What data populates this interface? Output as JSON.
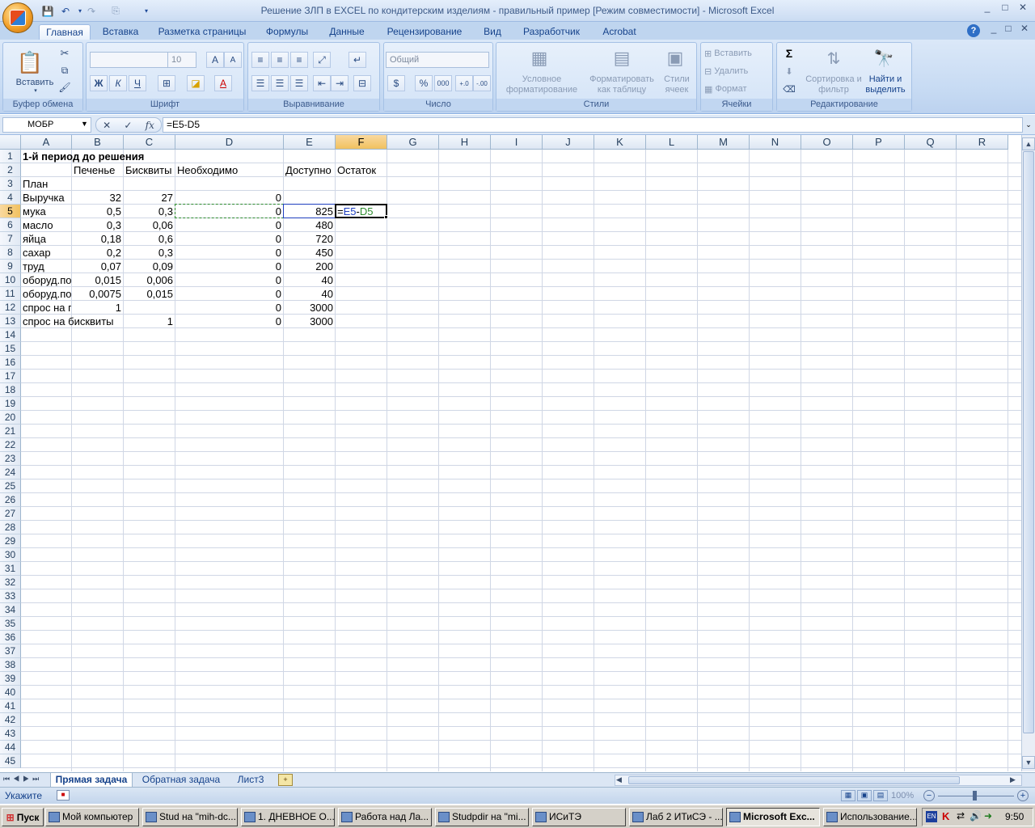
{
  "window": {
    "title": "Решение ЗЛП в EXCEL по кондитерским изделиям - правильный пример  [Режим совместимости] - Microsoft Excel",
    "min": "_",
    "max": "□",
    "close": "✕"
  },
  "ribbon_tabs": [
    "Главная",
    "Вставка",
    "Разметка страницы",
    "Формулы",
    "Данные",
    "Рецензирование",
    "Вид",
    "Разработчик",
    "Acrobat"
  ],
  "ribbon": {
    "clipboard": {
      "label": "Буфер обмена",
      "paste": "Вставить"
    },
    "font": {
      "label": "Шрифт",
      "font_name": "",
      "font_size": "10",
      "bold": "Ж",
      "italic": "К",
      "underline": "Ч",
      "grow": "A",
      "shrink": "A",
      "color": "A"
    },
    "alignment": {
      "label": "Выравнивание"
    },
    "number": {
      "label": "Число",
      "format": "Общий",
      "percent": "%",
      "thousands": "000"
    },
    "styles": {
      "label": "Стили",
      "conditional": "Условное форматирование",
      "as_table": "Форматировать как таблицу",
      "cell_styles": "Стили ячеек"
    },
    "cells": {
      "label": "Ячейки",
      "insert": "Вставить",
      "delete": "Удалить",
      "format": "Формат"
    },
    "editing": {
      "label": "Редактирование",
      "sum": "Σ",
      "sort": "Сортировка и фильтр",
      "find": "Найти и выделить"
    }
  },
  "formula_bar": {
    "name_box": "МОБР",
    "formula": "=E5-D5",
    "cancel": "✕",
    "enter": "✓",
    "fx": "fx"
  },
  "columns": [
    "A",
    "B",
    "C",
    "D",
    "E",
    "F",
    "G",
    "H",
    "I",
    "J",
    "K",
    "L",
    "M",
    "N",
    "O",
    "P",
    "Q",
    "R"
  ],
  "selected_column": "F",
  "selected_row": 5,
  "row_count": 45,
  "cells": {
    "A1": "1-й период до решения",
    "B2": "Печенье",
    "C2": "Бисквиты",
    "D2": "Необходимо",
    "E2": "Доступно",
    "F2": "Остаток",
    "A3": "План",
    "A4": "Выручка",
    "B4": "32",
    "C4": "27",
    "D4": "0",
    "A5": "мука",
    "B5": "0,5",
    "C5": "0,3",
    "D5": "0",
    "E5": "825",
    "A6": "масло",
    "B6": "0,3",
    "C6": "0,06",
    "D6": "0",
    "E6": "480",
    "A7": "яйца",
    "B7": "0,18",
    "C7": "0,6",
    "D7": "0",
    "E7": "720",
    "A8": "сахар",
    "B8": "0,2",
    "C8": "0,3",
    "D8": "0",
    "E8": "450",
    "A9": "труд",
    "B9": "0,07",
    "C9": "0,09",
    "D9": "0",
    "E9": "200",
    "A10": "оборуд.по",
    "B10": "0,015",
    "C10": "0,006",
    "D10": "0",
    "E10": "40",
    "A11": "оборуд.по",
    "B11": "0,0075",
    "C11": "0,015",
    "D11": "0",
    "E11": "40",
    "A12": "спрос на п",
    "B12": "1",
    "D12": "0",
    "E12": "3000",
    "A13": "спрос на бисквиты",
    "C13": "1",
    "D13": "0",
    "E13": "3000"
  },
  "edit_cell": {
    "ref": "F5",
    "eq": "=",
    "ref1": "E5",
    "op": "-",
    "ref2": "D5",
    "ref1_color": "#1f3fbf",
    "ref2_color": "#2e8b2e"
  },
  "sheets": [
    "Прямая задача",
    "Обратная задача",
    "Лист3"
  ],
  "active_sheet": 0,
  "status": {
    "mode": "Укажите",
    "zoom": "100%"
  },
  "taskbar": {
    "start": "Пуск",
    "items": [
      "Мой компьютер",
      "Stud на \"mih-dc...",
      "1. ДНЕВНОЕ О...",
      "Работа над Ла...",
      "Studpdir на \"mi...",
      "ИСиТЭ",
      "Лаб 2 ИТиСЭ - ...",
      "Microsoft Exc...",
      "Использование..."
    ],
    "active": 7,
    "lang": "EN",
    "clock": "9:50"
  }
}
